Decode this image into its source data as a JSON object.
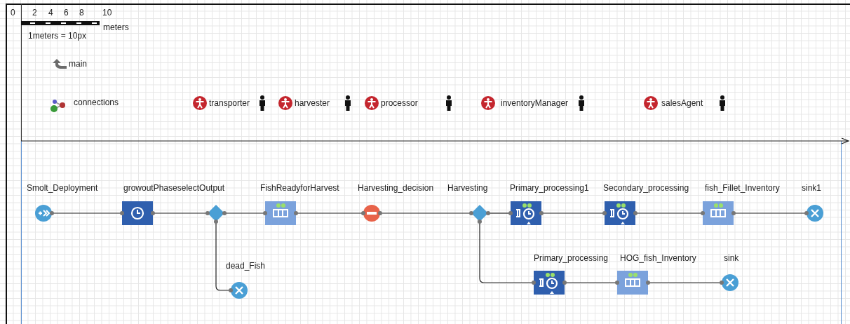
{
  "ruler": {
    "origin": "0",
    "ticks": [
      "2",
      "4",
      "6",
      "8",
      "10"
    ],
    "unit": "meters",
    "scale": "1meters = 10px"
  },
  "main": {
    "label": "main"
  },
  "connections": {
    "label": "connections"
  },
  "agents": [
    {
      "label": "transporter"
    },
    {
      "label": "harvester"
    },
    {
      "label": "processor"
    },
    {
      "label": "inventoryManager"
    },
    {
      "label": "salesAgent"
    }
  ],
  "blocks": [
    {
      "label": "Smolt_Deployment",
      "kind": "source"
    },
    {
      "label": "growoutPhaseselectOutput",
      "kind": "delay"
    },
    {
      "kind": "select"
    },
    {
      "label": "FishReadyforHarvest",
      "kind": "queue"
    },
    {
      "label": "Harvesting_decision",
      "kind": "hold"
    },
    {
      "label": "Harvesting",
      "kind": "select"
    },
    {
      "label": "Primary_processing1",
      "kind": "service"
    },
    {
      "label": "Secondary_processing",
      "kind": "service"
    },
    {
      "label": "fish_Fillet_Inventory",
      "kind": "queue"
    },
    {
      "label": "sink1",
      "kind": "sink"
    },
    {
      "label": "dead_Fish",
      "kind": "sink"
    },
    {
      "label": "Primary_processing",
      "kind": "service"
    },
    {
      "label": "HOG_fish_Inventory",
      "kind": "queue"
    },
    {
      "label": "sink",
      "kind": "sink"
    }
  ]
}
